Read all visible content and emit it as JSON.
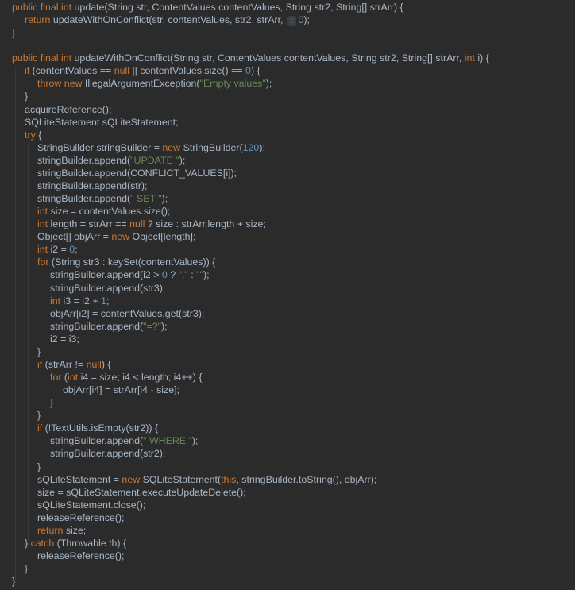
{
  "colors": {
    "background": "#2b2b2b",
    "plain": "#a9b7c6",
    "keyword": "#cc7832",
    "string": "#6a8759",
    "number": "#6897bb"
  },
  "editor": {
    "lines": [
      {
        "indent": 0,
        "tokens": [
          [
            "kw",
            "public final int "
          ],
          [
            "plain",
            "update(String str, ContentValues contentValues, String str2, String[] strArr) {"
          ]
        ]
      },
      {
        "indent": 1,
        "tokens": [
          [
            "kw",
            "return "
          ],
          [
            "plain",
            "updateWithOnConflict(str, contentValues, str2, strArr, "
          ],
          [
            "hint",
            "i:"
          ],
          [
            "num",
            "0"
          ],
          [
            "plain",
            ");"
          ]
        ]
      },
      {
        "indent": 0,
        "tokens": [
          [
            "plain",
            "}"
          ]
        ]
      },
      {
        "indent": 0,
        "tokens": []
      },
      {
        "indent": 0,
        "tokens": [
          [
            "kw",
            "public final int "
          ],
          [
            "plain",
            "updateWithOnConflict(String str, ContentValues contentValues, String str2, String[] strArr, "
          ],
          [
            "kw",
            "int "
          ],
          [
            "plain",
            "i) {"
          ]
        ]
      },
      {
        "indent": 1,
        "tokens": [
          [
            "kw",
            "if "
          ],
          [
            "plain",
            "(contentValues == "
          ],
          [
            "kw",
            "null "
          ],
          [
            "plain",
            "|| contentValues.size() == "
          ],
          [
            "num",
            "0"
          ],
          [
            "plain",
            ") {"
          ]
        ]
      },
      {
        "indent": 2,
        "tokens": [
          [
            "kw",
            "throw new "
          ],
          [
            "plain",
            "IllegalArgumentException("
          ],
          [
            "str",
            "\"Empty values\""
          ],
          [
            "plain",
            ");"
          ]
        ]
      },
      {
        "indent": 1,
        "tokens": [
          [
            "plain",
            "}"
          ]
        ]
      },
      {
        "indent": 1,
        "tokens": [
          [
            "plain",
            "acquireReference();"
          ]
        ]
      },
      {
        "indent": 1,
        "tokens": [
          [
            "plain",
            "SQLiteStatement sQLiteStatement;"
          ]
        ]
      },
      {
        "indent": 1,
        "tokens": [
          [
            "kw",
            "try "
          ],
          [
            "plain",
            "{"
          ]
        ]
      },
      {
        "indent": 2,
        "tokens": [
          [
            "plain",
            "StringBuilder stringBuilder = "
          ],
          [
            "kw",
            "new "
          ],
          [
            "plain",
            "StringBuilder("
          ],
          [
            "num",
            "120"
          ],
          [
            "plain",
            ");"
          ]
        ]
      },
      {
        "indent": 2,
        "tokens": [
          [
            "plain",
            "stringBuilder.append("
          ],
          [
            "str",
            "\"UPDATE \""
          ],
          [
            "plain",
            ");"
          ]
        ]
      },
      {
        "indent": 2,
        "tokens": [
          [
            "plain",
            "stringBuilder.append(CONFLICT_VALUES[i]);"
          ]
        ]
      },
      {
        "indent": 2,
        "tokens": [
          [
            "plain",
            "stringBuilder.append(str);"
          ]
        ]
      },
      {
        "indent": 2,
        "tokens": [
          [
            "plain",
            "stringBuilder.append("
          ],
          [
            "str",
            "\" SET \""
          ],
          [
            "plain",
            ");"
          ]
        ]
      },
      {
        "indent": 2,
        "tokens": [
          [
            "kw",
            "int "
          ],
          [
            "plain",
            "size = contentValues.size();"
          ]
        ]
      },
      {
        "indent": 2,
        "tokens": [
          [
            "kw",
            "int "
          ],
          [
            "plain",
            "length = strArr == "
          ],
          [
            "kw",
            "null "
          ],
          [
            "plain",
            "? size : strArr.length + size;"
          ]
        ]
      },
      {
        "indent": 2,
        "tokens": [
          [
            "plain",
            "Object[] objArr = "
          ],
          [
            "kw",
            "new "
          ],
          [
            "plain",
            "Object[length];"
          ]
        ]
      },
      {
        "indent": 2,
        "tokens": [
          [
            "kw",
            "int "
          ],
          [
            "plain",
            "i2 = "
          ],
          [
            "num",
            "0"
          ],
          [
            "plain",
            ";"
          ]
        ]
      },
      {
        "indent": 2,
        "tokens": [
          [
            "kw",
            "for "
          ],
          [
            "plain",
            "(String str3 : keySet(contentValues)) {"
          ]
        ]
      },
      {
        "indent": 3,
        "tokens": [
          [
            "plain",
            "stringBuilder.append(i2 > "
          ],
          [
            "num",
            "0 "
          ],
          [
            "plain",
            "? "
          ],
          [
            "str",
            "\",\" "
          ],
          [
            "plain",
            ": "
          ],
          [
            "str",
            "\"\""
          ],
          [
            "plain",
            ");"
          ]
        ]
      },
      {
        "indent": 3,
        "tokens": [
          [
            "plain",
            "stringBuilder.append(str3);"
          ]
        ]
      },
      {
        "indent": 3,
        "tokens": [
          [
            "kw",
            "int "
          ],
          [
            "plain",
            "i3 = i2 + "
          ],
          [
            "num",
            "1"
          ],
          [
            "plain",
            ";"
          ]
        ]
      },
      {
        "indent": 3,
        "tokens": [
          [
            "plain",
            "objArr[i2] = contentValues.get(str3);"
          ]
        ]
      },
      {
        "indent": 3,
        "tokens": [
          [
            "plain",
            "stringBuilder.append("
          ],
          [
            "str",
            "\"=?\""
          ],
          [
            "plain",
            ");"
          ]
        ]
      },
      {
        "indent": 3,
        "tokens": [
          [
            "plain",
            "i2 = i3;"
          ]
        ]
      },
      {
        "indent": 2,
        "tokens": [
          [
            "plain",
            "}"
          ]
        ]
      },
      {
        "indent": 2,
        "tokens": [
          [
            "kw",
            "if "
          ],
          [
            "plain",
            "(strArr != "
          ],
          [
            "kw",
            "null"
          ],
          [
            "plain",
            ") {"
          ]
        ]
      },
      {
        "indent": 3,
        "tokens": [
          [
            "kw",
            "for "
          ],
          [
            "plain",
            "("
          ],
          [
            "kw",
            "int "
          ],
          [
            "plain",
            "i4 = size; i4 < length; i4++) {"
          ]
        ]
      },
      {
        "indent": 4,
        "tokens": [
          [
            "plain",
            "objArr[i4] = strArr[i4 - size];"
          ]
        ]
      },
      {
        "indent": 3,
        "tokens": [
          [
            "plain",
            "}"
          ]
        ]
      },
      {
        "indent": 2,
        "tokens": [
          [
            "plain",
            "}"
          ]
        ]
      },
      {
        "indent": 2,
        "tokens": [
          [
            "kw",
            "if "
          ],
          [
            "plain",
            "(!TextUtils.isEmpty(str2)) {"
          ]
        ]
      },
      {
        "indent": 3,
        "tokens": [
          [
            "plain",
            "stringBuilder.append("
          ],
          [
            "str",
            "\" WHERE \""
          ],
          [
            "plain",
            ");"
          ]
        ]
      },
      {
        "indent": 3,
        "tokens": [
          [
            "plain",
            "stringBuilder.append(str2);"
          ]
        ]
      },
      {
        "indent": 2,
        "tokens": [
          [
            "plain",
            "}"
          ]
        ]
      },
      {
        "indent": 2,
        "tokens": [
          [
            "plain",
            "sQLiteStatement = "
          ],
          [
            "kw",
            "new "
          ],
          [
            "plain",
            "SQLiteStatement("
          ],
          [
            "kw",
            "this"
          ],
          [
            "plain",
            ", stringBuilder.toString(), objArr);"
          ]
        ]
      },
      {
        "indent": 2,
        "tokens": [
          [
            "plain",
            "size = sQLiteStatement.executeUpdateDelete();"
          ]
        ]
      },
      {
        "indent": 2,
        "tokens": [
          [
            "plain",
            "sQLiteStatement.close();"
          ]
        ]
      },
      {
        "indent": 2,
        "tokens": [
          [
            "plain",
            "releaseReference();"
          ]
        ]
      },
      {
        "indent": 2,
        "tokens": [
          [
            "kw",
            "return "
          ],
          [
            "plain",
            "size;"
          ]
        ]
      },
      {
        "indent": 1,
        "tokens": [
          [
            "plain",
            "} "
          ],
          [
            "kw",
            "catch "
          ],
          [
            "plain",
            "(Throwable th) {"
          ]
        ]
      },
      {
        "indent": 2,
        "tokens": [
          [
            "plain",
            "releaseReference();"
          ]
        ]
      },
      {
        "indent": 1,
        "tokens": [
          [
            "plain",
            "}"
          ]
        ]
      },
      {
        "indent": 0,
        "tokens": [
          [
            "plain",
            "}"
          ]
        ]
      }
    ]
  }
}
